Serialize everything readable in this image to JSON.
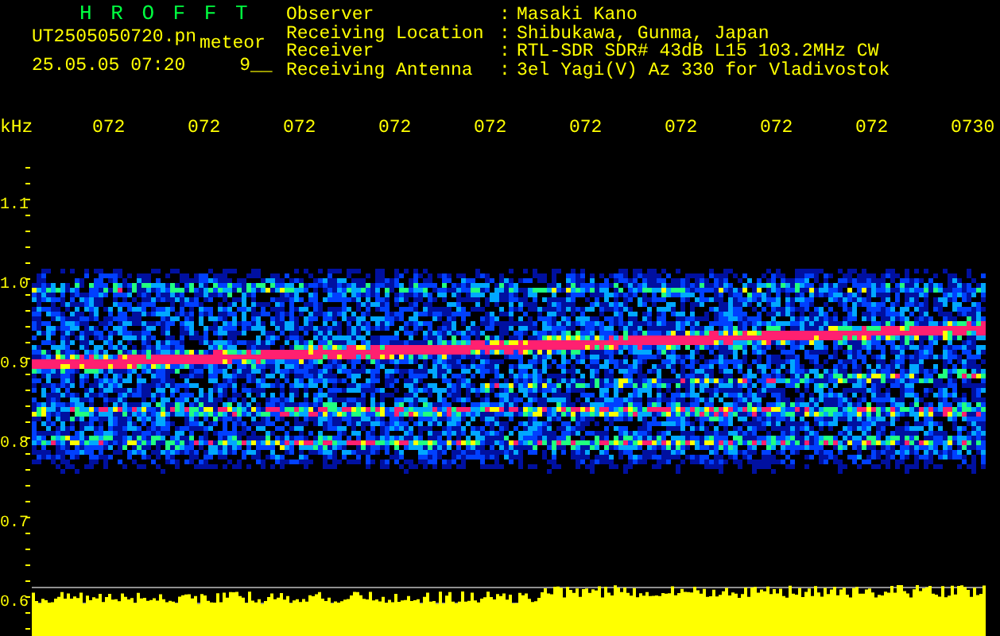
{
  "header": {
    "title": "H R O F F T",
    "filename": "UT2505050720.pn",
    "mode": "meteor",
    "timestamp": "25.05.05 07:20",
    "code": "9__"
  },
  "info": [
    {
      "label": "Observer",
      "separator": ":",
      "value": "Masaki Kano"
    },
    {
      "label": "Receiving Location",
      "separator": ":",
      "value": "Shibukawa, Gunma, Japan"
    },
    {
      "label": "Receiver",
      "separator": ":",
      "value": "RTL-SDR SDR# 43dB L15 103.2MHz CW"
    },
    {
      "label": "Receiving Antenna",
      "separator": ":",
      "value": "3el Yagi(V) Az 330 for Vladivostok"
    }
  ],
  "time_axis": {
    "unit": "kHz",
    "labels": [
      "072",
      "072",
      "072",
      "072",
      "072",
      "072",
      "072",
      "072",
      "072",
      "0730"
    ]
  },
  "frequency_axis": {
    "labels": [
      "1.1",
      "1.0",
      "0.9",
      "0.8",
      "0.7",
      "0.6"
    ]
  }
}
